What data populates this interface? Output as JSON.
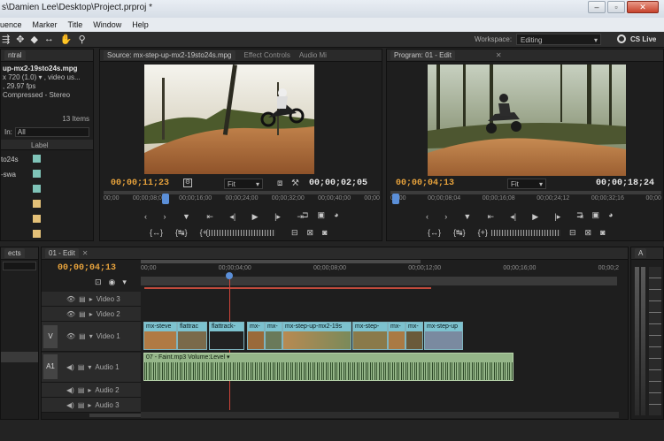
{
  "titlebar": {
    "text": "s\\Damien Lee\\Desktop\\Project.prproj *"
  },
  "menu": [
    "uence",
    "Marker",
    "Title",
    "Window",
    "Help"
  ],
  "workspace": {
    "label": "Workspace:",
    "value": "Editing",
    "cs_live": "CS Live"
  },
  "project": {
    "tab": "ntral",
    "clip_name": "up-mx2-19sto24s.mpg",
    "info": [
      "x 720 (1.0) ▾ , video us...",
      ", 29.97 fps",
      "Compressed - Stereo"
    ],
    "items": "13 Items",
    "in_label": "In:",
    "in_value": "All",
    "label_col": "Label",
    "rows": [
      {
        "name": "to24s",
        "color": "#7fc4b8"
      },
      {
        "name": "-swa",
        "color": "#7fc4b8"
      },
      {
        "name": "",
        "color": "#7fc4b8"
      },
      {
        "name": "",
        "color": "#e4c178"
      },
      {
        "name": "",
        "color": "#e4c178"
      },
      {
        "name": "",
        "color": "#e4c178"
      }
    ]
  },
  "source": {
    "tabs": [
      "Source: mx-step-up-mx2-19sto24s.mpg",
      "Effect Controls",
      "Audio Mi"
    ],
    "tc_left": "00;00;11;23",
    "tc_right": "00;00;02;05",
    "fit": "Fit",
    "ruler": [
      "00;00",
      "00;00;08;00",
      "00;00;16;00",
      "00;00;24;00",
      "00;00;32;00",
      "00;00;40;00",
      "00;00"
    ]
  },
  "program": {
    "tab": "Program: 01 - Edit",
    "tc_left": "00;00;04;13",
    "tc_right": "00;00;18;24",
    "fit": "Fit",
    "ruler": [
      "00;00",
      "00;00;08;04",
      "00;00;16;08",
      "00;00;24;12",
      "00;00;32;16",
      "00;00"
    ]
  },
  "effects": {
    "tab": "ects"
  },
  "timeline": {
    "tab": "01 - Edit",
    "tc": "00;00;04;13",
    "ruler": [
      "00;00",
      "00;00;04;00",
      "00;00;08;00",
      "00;00;12;00",
      "00;00;16;00",
      "00;00;2"
    ],
    "tracks": {
      "v3": "Video 3",
      "v2": "Video 2",
      "v1": "Video 1",
      "a1": "Audio 1",
      "a2": "Audio 2",
      "a3": "Audio 3",
      "v_tag": "V",
      "a_tag": "A1"
    },
    "video_clips": [
      "mx-steve",
      "flattrac",
      "flattrack-",
      "mx-",
      "mx-",
      "mx-step-up-mx2-19s",
      "mx-step-",
      "mx-",
      "mx-",
      "mx-step-up"
    ],
    "audio_clip": "07 - Faint.mp3  Volume:Level ▾"
  },
  "audio_meter": {
    "tab": "A"
  }
}
